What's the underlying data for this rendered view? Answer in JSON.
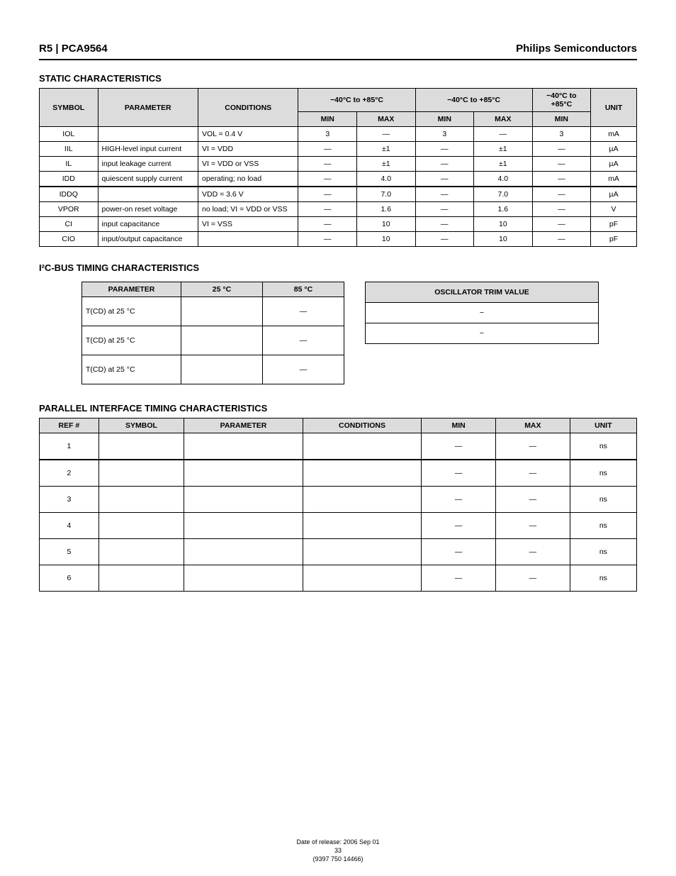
{
  "header": {
    "left": "R5 | PCA9564",
    "right": "Philips Semiconductors"
  },
  "section1": {
    "title": "STATIC CHARACTERISTICS",
    "headers": [
      "SYMBOL",
      "PARAMETER",
      "CONDITIONS",
      "−40°C to +85°C MIN",
      "MAX",
      "−40°C to +85°C MIN",
      "MAX",
      "−40°C to +85°C MIN",
      "UNIT"
    ],
    "h_row1": [
      "SYMBOL",
      "PARAMETER",
      "CONDITIONS",
      "−40°C to +85°C",
      "",
      "−40°C to +85°C",
      "",
      "−40°C to +85°C",
      "UNIT"
    ],
    "h_row2": [
      "",
      "",
      "",
      "MIN",
      "MAX",
      "MIN",
      "MAX",
      "MIN",
      ""
    ],
    "rows": [
      [
        "IOL",
        "",
        "VOL = 0.4 V",
        "3",
        "—",
        "3",
        "—",
        "3",
        "mA"
      ],
      [
        "IIL",
        "HIGH-level input current",
        "VI = VDD",
        "—",
        "±1",
        "—",
        "±1",
        "—",
        "µA"
      ],
      [
        "IL",
        "input leakage current",
        "VI = VDD or VSS",
        "—",
        "±1",
        "—",
        "±1",
        "—",
        "µA"
      ],
      [
        "IDD",
        "quiescent supply current",
        "operating; no load",
        "—",
        "4.0",
        "—",
        "4.0",
        "—",
        "mA"
      ],
      [
        "IDDQ",
        "",
        "VDD = 3.6 V",
        "—",
        "7.0",
        "—",
        "7.0",
        "—",
        "µA"
      ],
      [
        "VPOR",
        "power-on reset voltage",
        "no load; VI = VDD or VSS",
        "—",
        "1.6",
        "—",
        "1.6",
        "—",
        "V"
      ],
      [
        "CI",
        "input capacitance",
        "VI = VSS",
        "—",
        "10",
        "—",
        "10",
        "—",
        "pF"
      ],
      [
        "CIO",
        "input/output capacitance",
        "",
        "—",
        "10",
        "—",
        "10",
        "—",
        "pF"
      ]
    ]
  },
  "section2": {
    "title": "I²C-BUS TIMING CHARACTERISTICS",
    "t2": {
      "headers": [
        "PARAMETER",
        "25 °C",
        "85 °C"
      ],
      "rows": [
        [
          "T(CD) at 25 °C",
          "",
          "—"
        ],
        [
          "T(CD) at 25 °C",
          "",
          "—"
        ],
        [
          "T(CD) at 25 °C",
          "",
          "—"
        ]
      ]
    },
    "t3": {
      "headers": [
        "OSCILLATOR TRIM VALUE"
      ],
      "rows": [
        [
          "−"
        ],
        [
          "−"
        ]
      ]
    }
  },
  "section3": {
    "title": "PARALLEL INTERFACE TIMING CHARACTERISTICS",
    "headers": [
      "REF #",
      "SYMBOL",
      "PARAMETER",
      "CONDITIONS",
      "MIN",
      "MAX",
      "UNIT"
    ],
    "rows": [
      [
        "1",
        "",
        "",
        "",
        "—",
        "—",
        "ns"
      ],
      [
        "2",
        "",
        "",
        "",
        "—",
        "—",
        "ns"
      ],
      [
        "3",
        "",
        "",
        "",
        "—",
        "—",
        "ns"
      ],
      [
        "4",
        "",
        "",
        "",
        "—",
        "—",
        "ns"
      ],
      [
        "5",
        "",
        "",
        "",
        "—",
        "—",
        "ns"
      ],
      [
        "6",
        "",
        "",
        "",
        "—",
        "—",
        "ns"
      ]
    ]
  },
  "footer": {
    "date": "Date of release: 2006 Sep 01",
    "page": "33",
    "note": "(9397 750 14466)"
  }
}
